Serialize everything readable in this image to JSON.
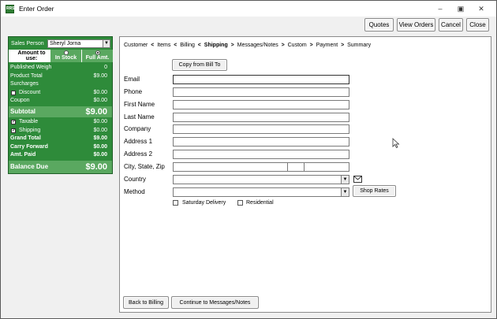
{
  "window": {
    "title": "Enter Order",
    "app_icon_text": "RRS"
  },
  "window_controls": {
    "minimize": "–",
    "restore": "▣",
    "close": "✕"
  },
  "top_buttons": {
    "quotes": "Quotes",
    "view_orders": "View Orders",
    "cancel": "Cancel",
    "close": "Close"
  },
  "summary": {
    "sales_person_label": "Sales Person",
    "sales_person_value": "Sheryl Jorna",
    "amount_to_use_label": "Amount to use:",
    "in_stock_label": "In Stock",
    "full_amt_label": "Full Amt.",
    "selected_option": "Full Amt.",
    "rows": {
      "published_weight": {
        "label": "Published Weigh",
        "value": "0"
      },
      "product_total": {
        "label": "Product Total",
        "value": "$9.00"
      },
      "surcharges": {
        "label": "Surcharges",
        "value": ""
      },
      "discount": {
        "label": "Discount",
        "value": "$0.00",
        "checked": false
      },
      "coupon": {
        "label": "Coupon",
        "value": "$0.00"
      },
      "subtotal": {
        "label": "Subtotal",
        "value": "$9.00"
      },
      "taxable": {
        "label": "Taxable",
        "value": "$0.00",
        "checked": true
      },
      "shipping": {
        "label": "Shipping",
        "value": "$0.00",
        "checked": true
      },
      "grand_total": {
        "label": "Grand Total",
        "value": "$9.00"
      },
      "carry_forward": {
        "label": "Carry Forward",
        "value": "$0.00"
      },
      "amt_paid": {
        "label": "Amt. Paid",
        "value": "$0.00"
      },
      "balance_due": {
        "label": "Balance Due",
        "value": "$9.00"
      }
    }
  },
  "steps": {
    "customer": "Customer",
    "items": "Items",
    "billing": "Billing",
    "shipping": "Shipping",
    "messages": "Messages/Notes",
    "custom": "Custom",
    "payment": "Payment",
    "summary": "Summary",
    "active": "Shipping",
    "sep1": "  <  ",
    "sep2": "  >  "
  },
  "form": {
    "copy_button": "Copy from Bill To",
    "email_label": "Email",
    "phone_label": "Phone",
    "first_name_label": "First Name",
    "last_name_label": "Last Name",
    "company_label": "Company",
    "address1_label": "Address 1",
    "address2_label": "Address 2",
    "city_state_zip_label": "City, State, Zip",
    "country_label": "Country",
    "method_label": "Method",
    "shop_rates_button": "Shop Rates",
    "saturday_delivery_label": "Saturday Delivery",
    "residential_label": "Residential",
    "email_value": "",
    "phone_value": "",
    "first_name_value": "",
    "last_name_value": "",
    "company_value": "",
    "address1_value": "",
    "address2_value": "",
    "city_value": "",
    "state_value": "",
    "zip_value": "",
    "country_value": "",
    "method_value": ""
  },
  "bottom_buttons": {
    "back": "Back to Billing",
    "continue": "Continue to Messages/Notes"
  },
  "colors": {
    "panel_green": "#2e8b3a",
    "panel_light_green": "#5aa860"
  }
}
